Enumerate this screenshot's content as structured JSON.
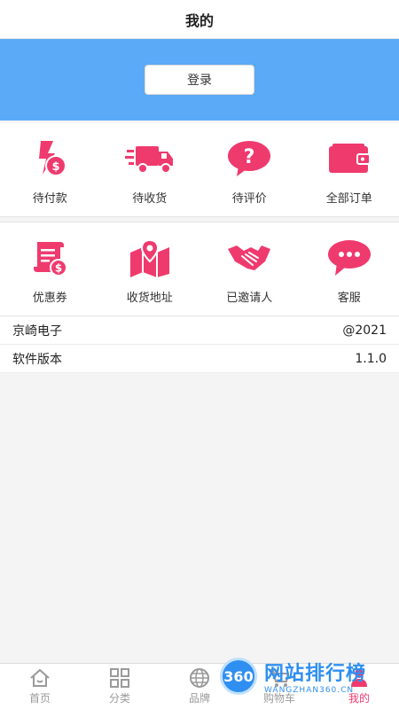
{
  "header": {
    "title": "我的"
  },
  "hero": {
    "login_label": "登录"
  },
  "orders": [
    {
      "label": "待付款",
      "icon": "pending-payment-icon"
    },
    {
      "label": "待收货",
      "icon": "delivery-truck-icon"
    },
    {
      "label": "待评价",
      "icon": "question-bubble-icon"
    },
    {
      "label": "全部订单",
      "icon": "wallet-icon"
    }
  ],
  "services": [
    {
      "label": "优惠券",
      "icon": "coupon-scroll-icon"
    },
    {
      "label": "收货地址",
      "icon": "map-pin-icon"
    },
    {
      "label": "已邀请人",
      "icon": "handshake-icon"
    },
    {
      "label": "客服",
      "icon": "chat-bubble-icon"
    }
  ],
  "info": [
    {
      "label": "京崎电子",
      "value": "@2021"
    },
    {
      "label": "软件版本",
      "value": "1.1.0"
    }
  ],
  "tabbar": [
    {
      "label": "首页",
      "icon": "home-icon"
    },
    {
      "label": "分类",
      "icon": "category-grid-icon"
    },
    {
      "label": "品牌",
      "icon": "globe-icon"
    },
    {
      "label": "购物车",
      "icon": "cart-icon"
    },
    {
      "label": "我的",
      "icon": "user-icon",
      "active": true
    }
  ],
  "watermark": {
    "badge": "360",
    "title": "网站排行榜",
    "subtitle": "WANGZHAN360.CN"
  },
  "colors": {
    "accent": "#ef3a6e",
    "hero_bg": "#5aaaf7",
    "watermark": "#2f8ff0"
  }
}
